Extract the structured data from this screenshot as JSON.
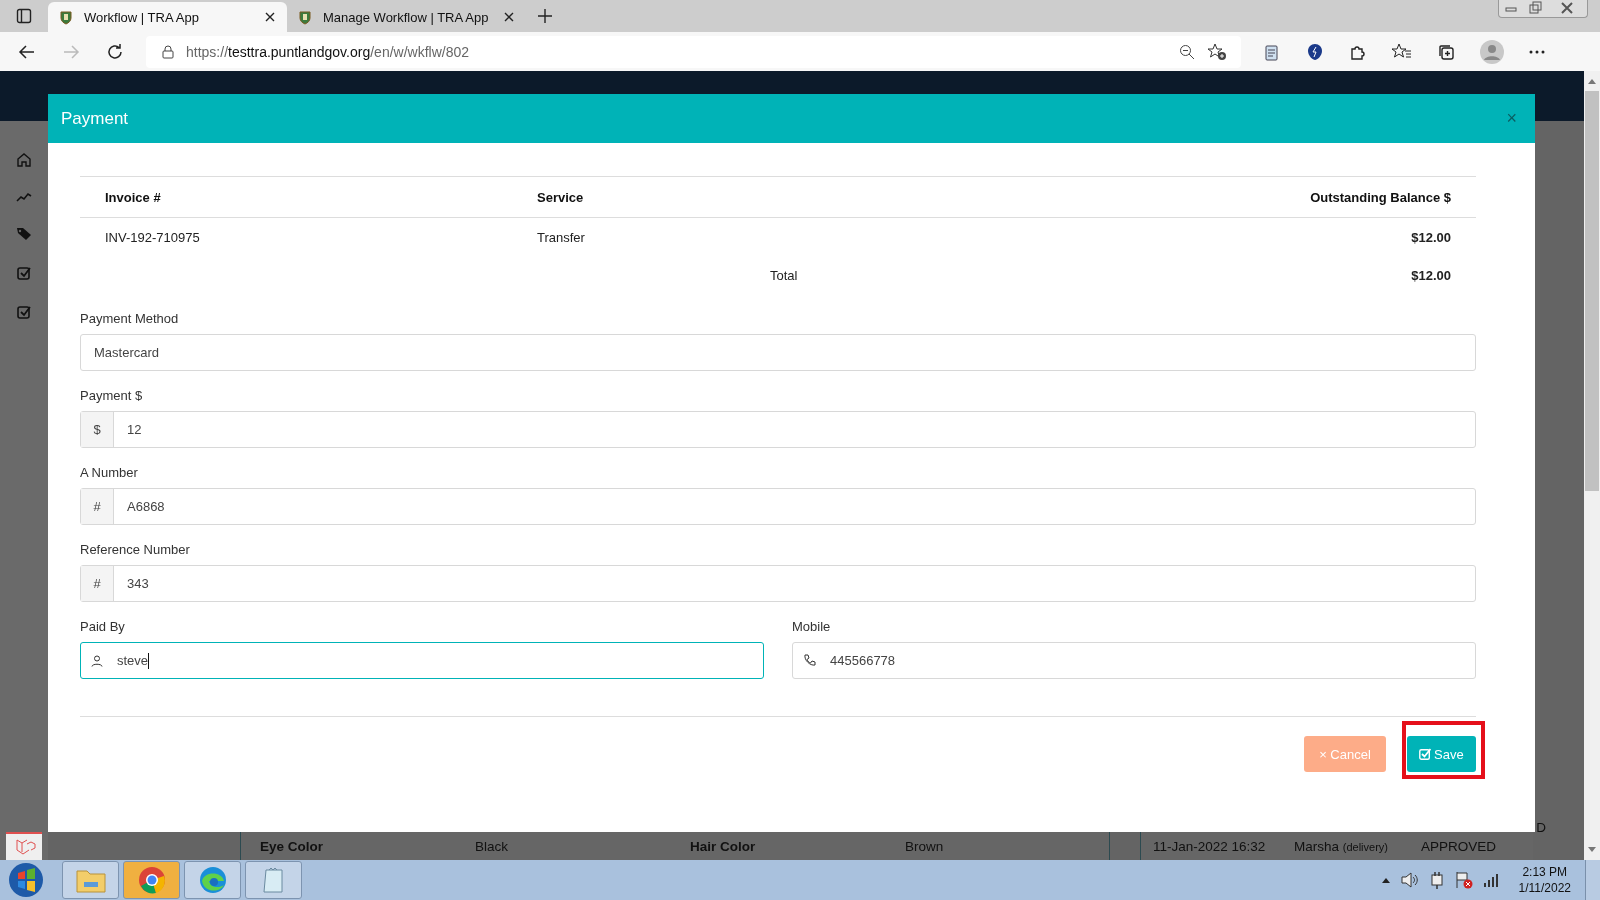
{
  "browser": {
    "tabs": [
      {
        "title": "Workflow | TRA App",
        "selected": true
      },
      {
        "title": "Manage Workflow | TRA App",
        "selected": false
      }
    ],
    "url": {
      "scheme": "https://",
      "host": "testtra.puntlandgov.org",
      "path": "/en/w/wkflw/802"
    }
  },
  "background": {
    "details": [
      {
        "label": "Eye Color",
        "value": "Black"
      },
      {
        "label": "Hair Color",
        "value": "Brown"
      }
    ],
    "history": {
      "date": "11-Jan-2022 16:32",
      "user": "Marsha",
      "role": "(delivery)",
      "status": "APPROVED"
    },
    "cut_text": "D"
  },
  "modal": {
    "title": "Payment",
    "close": "×",
    "table": {
      "columns": [
        "Invoice #",
        "Service",
        "Outstanding Balance $"
      ],
      "rows": [
        [
          "INV-192-710975",
          "Transfer",
          "$12.00"
        ]
      ],
      "total_label": "Total",
      "total": "$12.00"
    },
    "fields": [
      {
        "kind": "select",
        "label": "Payment Method",
        "value": "Mastercard"
      },
      {
        "kind": "addon",
        "label": "Payment $",
        "addon": "$",
        "value": "12"
      },
      {
        "kind": "addon",
        "label": "A Number",
        "addon": "#",
        "value": "A6868"
      },
      {
        "kind": "addon",
        "label": "Reference Number",
        "addon": "#",
        "value": "343"
      }
    ],
    "contact": [
      {
        "kind": "person",
        "label": "Paid By",
        "value": "steve",
        "focused": true
      },
      {
        "kind": "phone",
        "label": "Mobile",
        "value": "445566778",
        "focused": false
      }
    ],
    "buttons": [
      {
        "kind": "cancel",
        "icon": "×",
        "label": "Cancel",
        "highlighted": false
      },
      {
        "kind": "save",
        "label": "Save",
        "highlighted": true
      }
    ]
  },
  "taskbar": {
    "time": "2:13 PM",
    "date": "1/11/2022"
  }
}
